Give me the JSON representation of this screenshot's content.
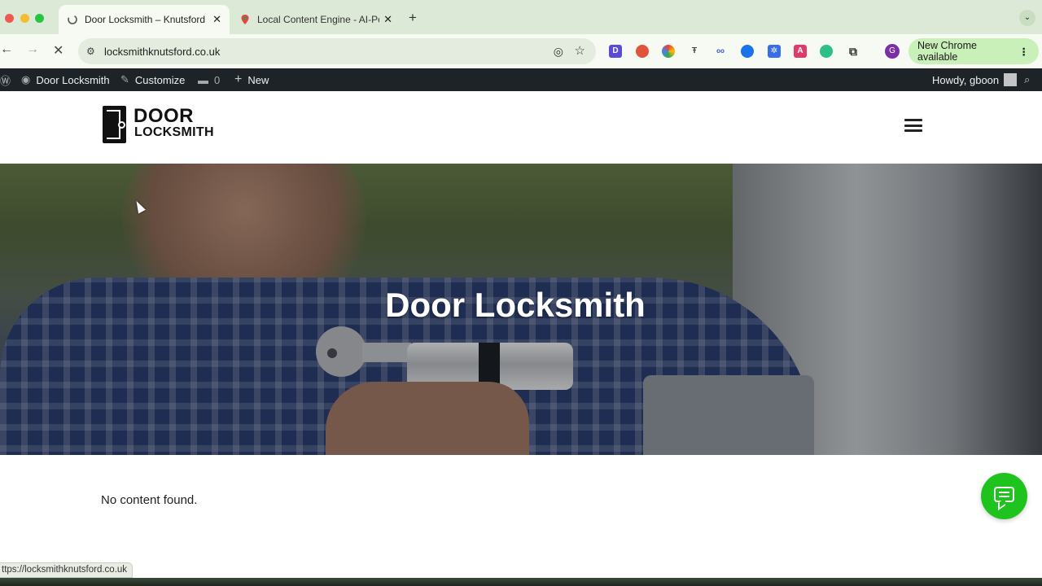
{
  "browser": {
    "tabs": [
      {
        "title": "Door Locksmith – Knutsford E",
        "active": true
      },
      {
        "title": "Local Content Engine - AI-Po",
        "active": false
      }
    ],
    "address": "locksmithknutsford.co.uk",
    "update_button": "New Chrome available",
    "profile_initial": "G",
    "status_url": "ttps://locksmithknutsford.co.uk"
  },
  "admin_bar": {
    "site_name": "Door Locksmith",
    "customize": "Customize",
    "comments_count": "0",
    "new": "New",
    "greeting": "Howdy, gboon"
  },
  "site": {
    "logo_line1": "DOOR",
    "logo_line2": "LOCKSMITH",
    "hero_title": "Door Locksmith",
    "content_message": "No content found."
  },
  "colors": {
    "admin_bar_bg": "#1d2327",
    "chat_button": "#1ec31e",
    "update_button_bg": "#c9f0b8"
  }
}
